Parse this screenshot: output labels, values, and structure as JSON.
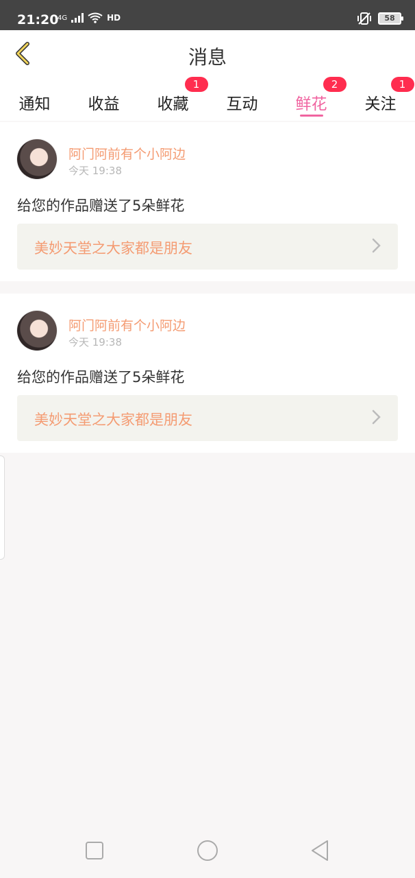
{
  "status_bar": {
    "time": "21:20",
    "network": "4G",
    "hd": "HD",
    "battery": "58"
  },
  "header": {
    "title": "消息"
  },
  "tabs": [
    {
      "label": "通知",
      "badge": ""
    },
    {
      "label": "收益",
      "badge": ""
    },
    {
      "label": "收藏",
      "badge": "1"
    },
    {
      "label": "互动",
      "badge": ""
    },
    {
      "label": "鲜花",
      "badge": "2",
      "active": true
    },
    {
      "label": "关注",
      "badge": "1"
    }
  ],
  "messages": [
    {
      "username": "阿门阿前有个小阿边",
      "time": "今天 19:38",
      "text": "给您的作品赠送了5朵鲜花",
      "work_title": "美妙天堂之大家都是朋友"
    },
    {
      "username": "阿门阿前有个小阿边",
      "time": "今天 19:38",
      "text": "给您的作品赠送了5朵鲜花",
      "work_title": "美妙天堂之大家都是朋友"
    }
  ],
  "colors": {
    "accent": "#f064a0",
    "username": "#f49b72",
    "badge": "#ff2d4f"
  }
}
